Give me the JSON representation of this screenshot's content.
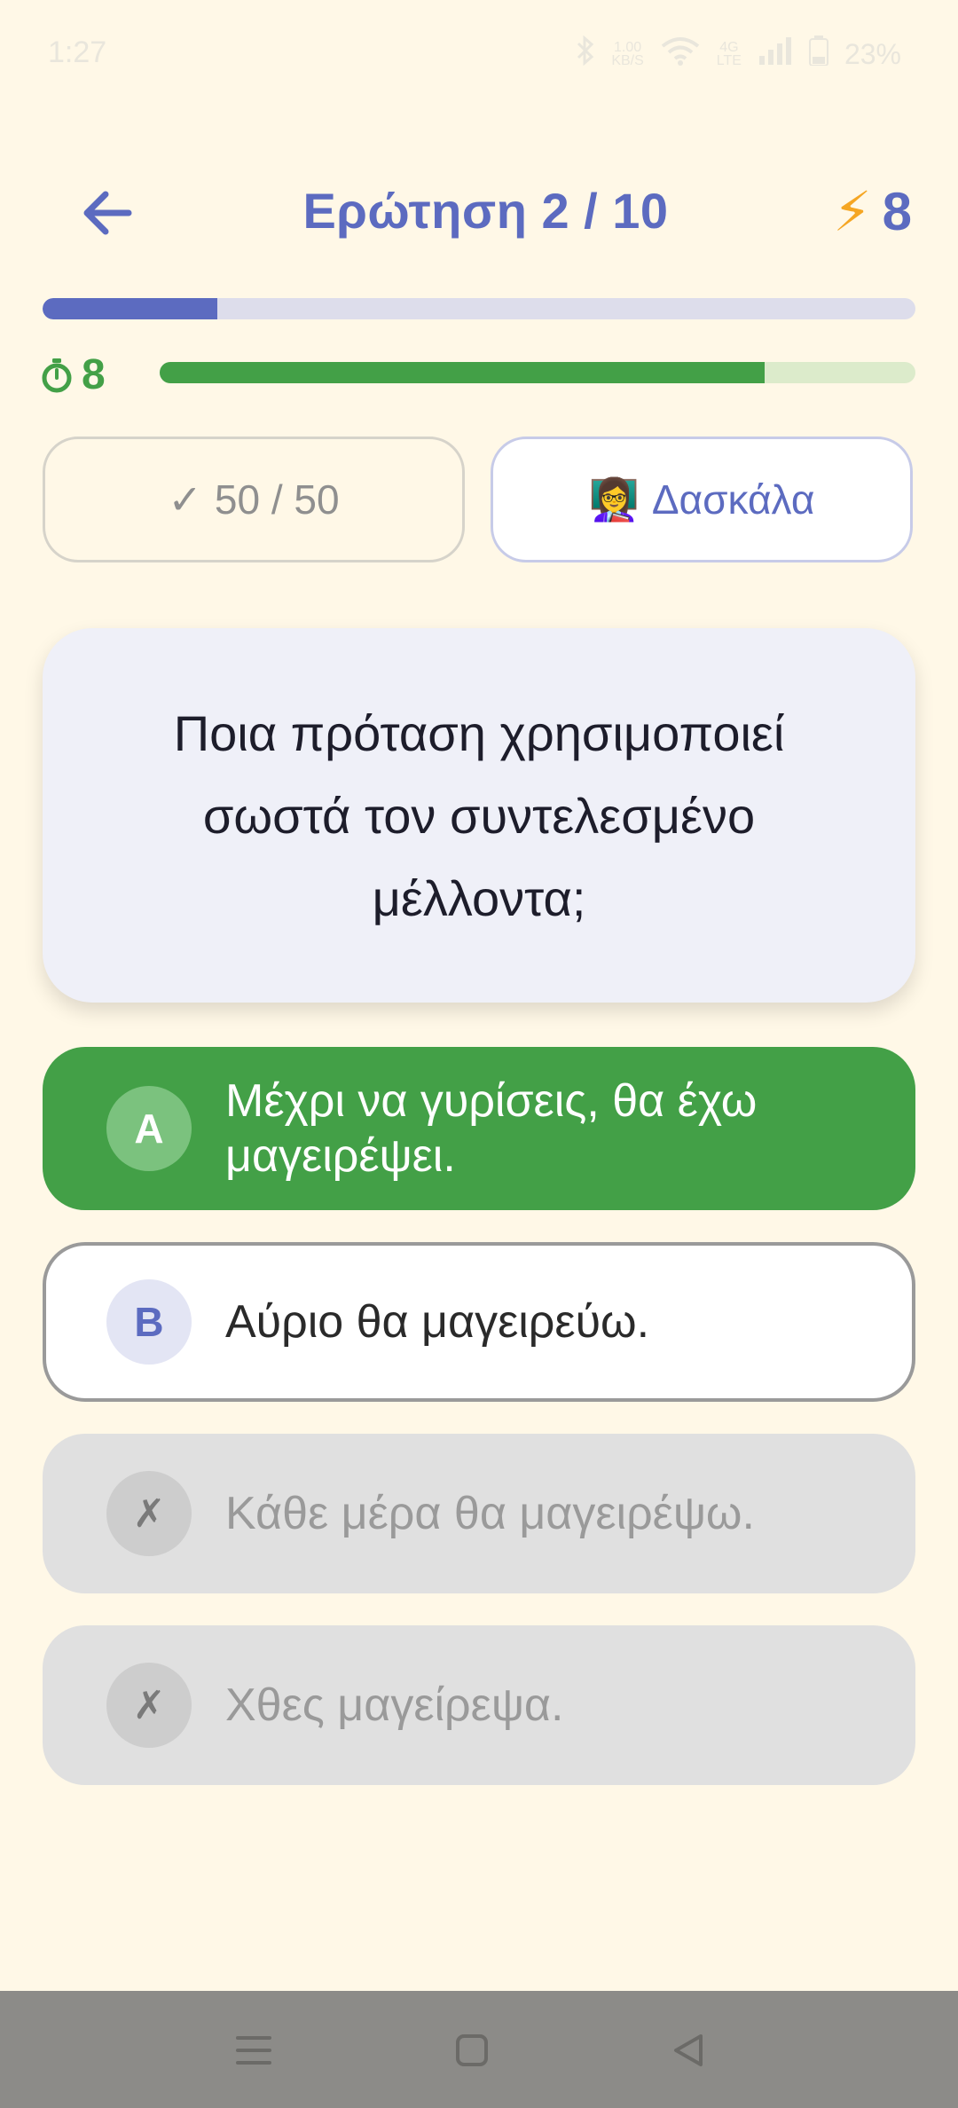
{
  "status_bar": {
    "time": "1:27",
    "net_speed": "1.00",
    "net_unit": "KB/S",
    "network_type": "4G",
    "network_sub": "LTE",
    "battery": "23%"
  },
  "header": {
    "title": "Ερώτηση 2 / 10",
    "streak_value": "8"
  },
  "progress": {
    "question_fraction": 0.2
  },
  "timer": {
    "seconds": "8",
    "fraction": 0.8
  },
  "lifelines": {
    "fifty_fifty_label": "50 / 50",
    "fifty_fifty_check": "✓",
    "teacher_label": "Δασκάλα",
    "teacher_emoji": "👩‍🏫"
  },
  "question": {
    "text": "Ποια πρόταση χρησιμοποιεί σωστά τον συντελεσμένο μέλλοντα;"
  },
  "answers": [
    {
      "letter": "A",
      "text": "Μέχρι να γυρίσεις, θα έχω μαγειρέψει.",
      "state": "correct"
    },
    {
      "letter": "B",
      "text": "Αύριο θα μαγειρεύω.",
      "state": "selectable"
    },
    {
      "letter": "✗",
      "text": "Κάθε μέρα θα μαγειρέψω.",
      "state": "eliminated"
    },
    {
      "letter": "✗",
      "text": "Χθες μαγείρεψα.",
      "state": "eliminated"
    }
  ],
  "colors": {
    "background": "#FFF8E7",
    "accent": "#5C6BC0",
    "correct": "#43A047",
    "bolt": "#F5A623"
  }
}
